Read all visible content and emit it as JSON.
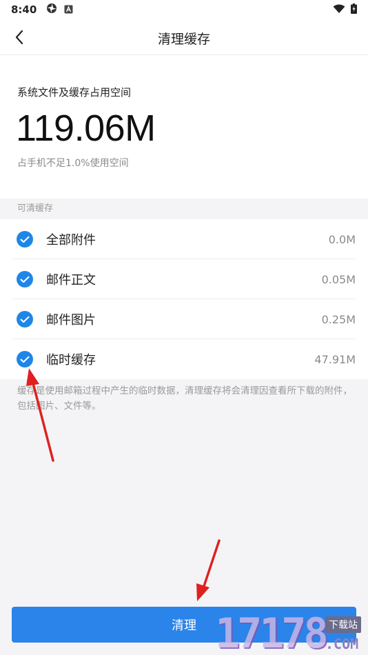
{
  "status_bar": {
    "time": "8:40",
    "icons": [
      "app-icon",
      "notification-a-icon",
      "wifi-icon",
      "battery-icon"
    ]
  },
  "header": {
    "title": "清理缓存",
    "back_icon": "chevron-left-icon"
  },
  "summary": {
    "label": "系统文件及缓存占用空间",
    "size": "119.06M",
    "note": "占手机不足1.0%使用空间"
  },
  "section": {
    "title": "可清缓存"
  },
  "cache_items": [
    {
      "label": "全部附件",
      "size": "0.0M",
      "checked": true
    },
    {
      "label": "邮件正文",
      "size": "0.05M",
      "checked": true
    },
    {
      "label": "邮件图片",
      "size": "0.25M",
      "checked": true
    },
    {
      "label": "临时缓存",
      "size": "47.91M",
      "checked": true
    }
  ],
  "description": "缓存是使用邮箱过程中产生的临时数据，清理缓存将会清理因查看所下载的附件，包括图片、文件等。",
  "clean_button": {
    "label": "清理"
  },
  "watermark": {
    "number": "17178",
    "tag": "下载站",
    "domain": ".COM"
  },
  "colors": {
    "accent": "#2a84ea",
    "check": "#1f86e8",
    "annotation": "#e02020"
  }
}
